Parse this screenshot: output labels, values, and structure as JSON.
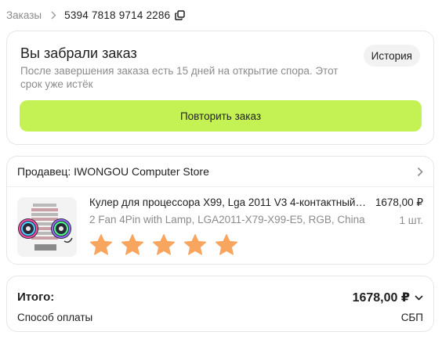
{
  "breadcrumb": {
    "parent": "Заказы",
    "order_number": "5394 7818 9714 2286"
  },
  "status": {
    "title": "Вы забрали заказ",
    "description": "После завершения заказа есть 15 дней на открытие спора. Этот срок уже истёк",
    "history_label": "История",
    "repeat_label": "Повторить заказ"
  },
  "seller": {
    "label": "Продавец: IWONGOU Computer Store"
  },
  "product": {
    "title": "Кулер для процессора X99, Lga 2011 V3 4-контактный…",
    "variant": "2 Fan 4Pin with Lamp, LGA2011-X79-X99-E5, RGB, China",
    "price": "1678,00 ₽",
    "quantity": "1 шт.",
    "rating_stars": 5,
    "star_icon": "star-icon"
  },
  "total": {
    "label": "Итого:",
    "value": "1678,00 ₽",
    "payment_label": "Способ оплаты",
    "payment_value": "СБП"
  },
  "colors": {
    "accent_button": "#c4f255",
    "star": "#f8a55f",
    "muted_text": "#8c8c8c"
  }
}
